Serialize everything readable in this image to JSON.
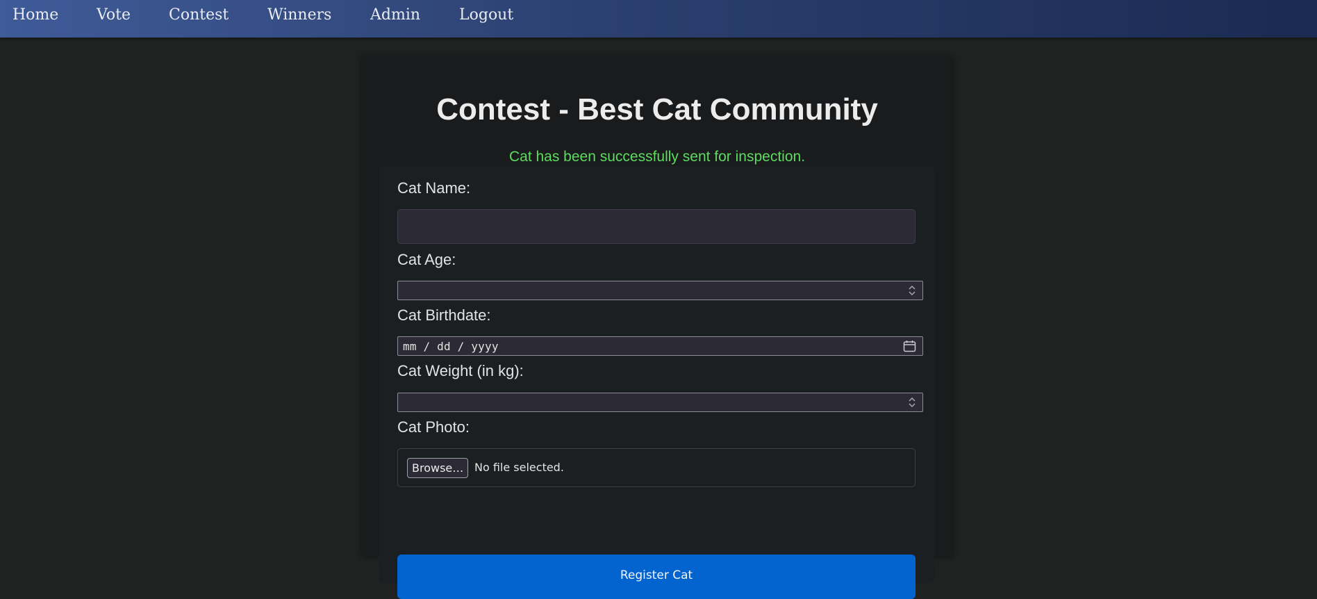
{
  "nav": {
    "items": [
      {
        "label": "Home"
      },
      {
        "label": "Vote"
      },
      {
        "label": "Contest"
      },
      {
        "label": "Winners"
      },
      {
        "label": "Admin"
      },
      {
        "label": "Logout"
      }
    ]
  },
  "page": {
    "title": "Contest - Best Cat Community",
    "success_message": "Cat has been successfully sent for inspection."
  },
  "form": {
    "name_label": "Cat Name:",
    "name_value": "",
    "age_label": "Cat Age:",
    "age_value": "",
    "birthdate_label": "Cat Birthdate:",
    "birthdate_placeholder": "mm / dd / yyyy",
    "weight_label": "Cat Weight (in kg):",
    "weight_value": "",
    "photo_label": "Cat Photo:",
    "browse_label": "Browse…",
    "file_status": "No file selected.",
    "submit_label": "Register Cat"
  },
  "icons": {
    "spinner": "spinner-arrows-icon",
    "calendar": "calendar-icon"
  },
  "colors": {
    "nav_gradient_start": "#3f5b98",
    "nav_gradient_end": "#1a2a52",
    "success_text": "#5ddc5f",
    "primary_button": "#0364d0",
    "page_background": "#1f2221"
  }
}
